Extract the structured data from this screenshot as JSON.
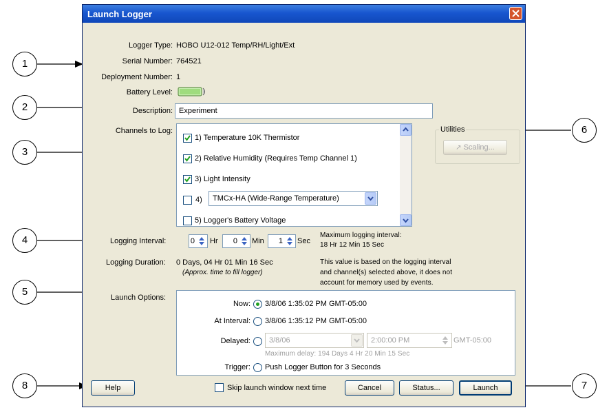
{
  "window": {
    "title": "Launch Logger"
  },
  "info": {
    "logger_type_label": "Logger Type:",
    "logger_type_value": "HOBO U12-012 Temp/RH/Light/Ext",
    "serial_label": "Serial Number:",
    "serial_value": "764521",
    "deployment_label": "Deployment Number:",
    "deployment_value": "1",
    "battery_label": "Battery Level:"
  },
  "description": {
    "label": "Description:",
    "value": "Experiment"
  },
  "channels": {
    "label": "Channels to Log:",
    "items": [
      {
        "label": "1) Temperature 10K Thermistor",
        "checked": true
      },
      {
        "label": "2) Relative Humidity (Requires Temp Channel 1)",
        "checked": true
      },
      {
        "label": "3) Light Intensity",
        "checked": true
      },
      {
        "label": "4)",
        "checked": false,
        "select_value": "TMCx-HA (Wide-Range Temperature)"
      },
      {
        "label": "5) Logger's Battery Voltage",
        "checked": false
      }
    ]
  },
  "utilities": {
    "label": "Utilities",
    "scaling_button": "Scaling..."
  },
  "interval": {
    "label": "Logging Interval:",
    "hr_value": "0",
    "hr_unit": "Hr",
    "min_value": "0",
    "min_unit": "Min",
    "sec_value": "1",
    "sec_unit": "Sec",
    "max_label": "Maximum logging interval:",
    "max_value": "18 Hr 12 Min 15 Sec"
  },
  "duration": {
    "label": "Logging Duration:",
    "value": "0 Days, 04 Hr 01 Min 16 Sec",
    "approx": "(Approx. time to fill logger)",
    "note_1": "This value is based on the logging interval",
    "note_2": "and channel(s) selected above, it does not",
    "note_3": "account for memory used by events."
  },
  "launch_options": {
    "label": "Launch Options:",
    "now_label": "Now:",
    "now_value": "3/8/06 1:35:02 PM GMT-05:00",
    "interval_label": "At Interval:",
    "interval_value": "3/8/06 1:35:12 PM GMT-05:00",
    "delayed_label": "Delayed:",
    "delayed_date": "3/8/06",
    "delayed_time": "2:00:00 PM",
    "delayed_tz": "GMT-05:00",
    "max_delay": "Maximum delay: 194 Days 4 Hr 20 Min 15 Sec",
    "trigger_label": "Trigger:",
    "trigger_value": "Push Logger Button for 3 Seconds",
    "selected": "Now"
  },
  "footer": {
    "help": "Help",
    "skip": "Skip launch window next time",
    "cancel": "Cancel",
    "status": "Status...",
    "launch": "Launch"
  },
  "callouts": [
    "1",
    "2",
    "3",
    "4",
    "5",
    "6",
    "7",
    "8"
  ],
  "colors": {
    "title_bar": "#1856cf",
    "dialog_bg": "#ece9d8",
    "check": "#21a121",
    "close": "#d4542c"
  }
}
